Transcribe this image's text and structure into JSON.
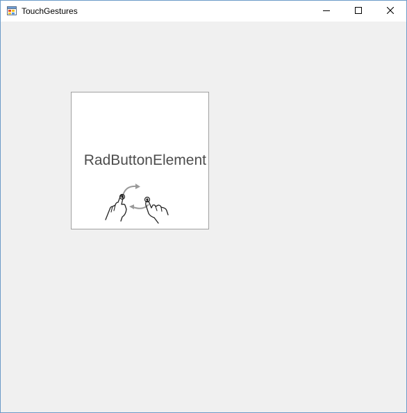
{
  "window": {
    "title": "TouchGestures",
    "icons": {
      "app": "form-app-icon",
      "minimize": "minimize-icon",
      "maximize": "maximize-icon",
      "close": "close-icon"
    }
  },
  "main": {
    "rad_button": {
      "label": "RadButtonElement",
      "image_icon": "rotate-gesture-icon"
    }
  }
}
